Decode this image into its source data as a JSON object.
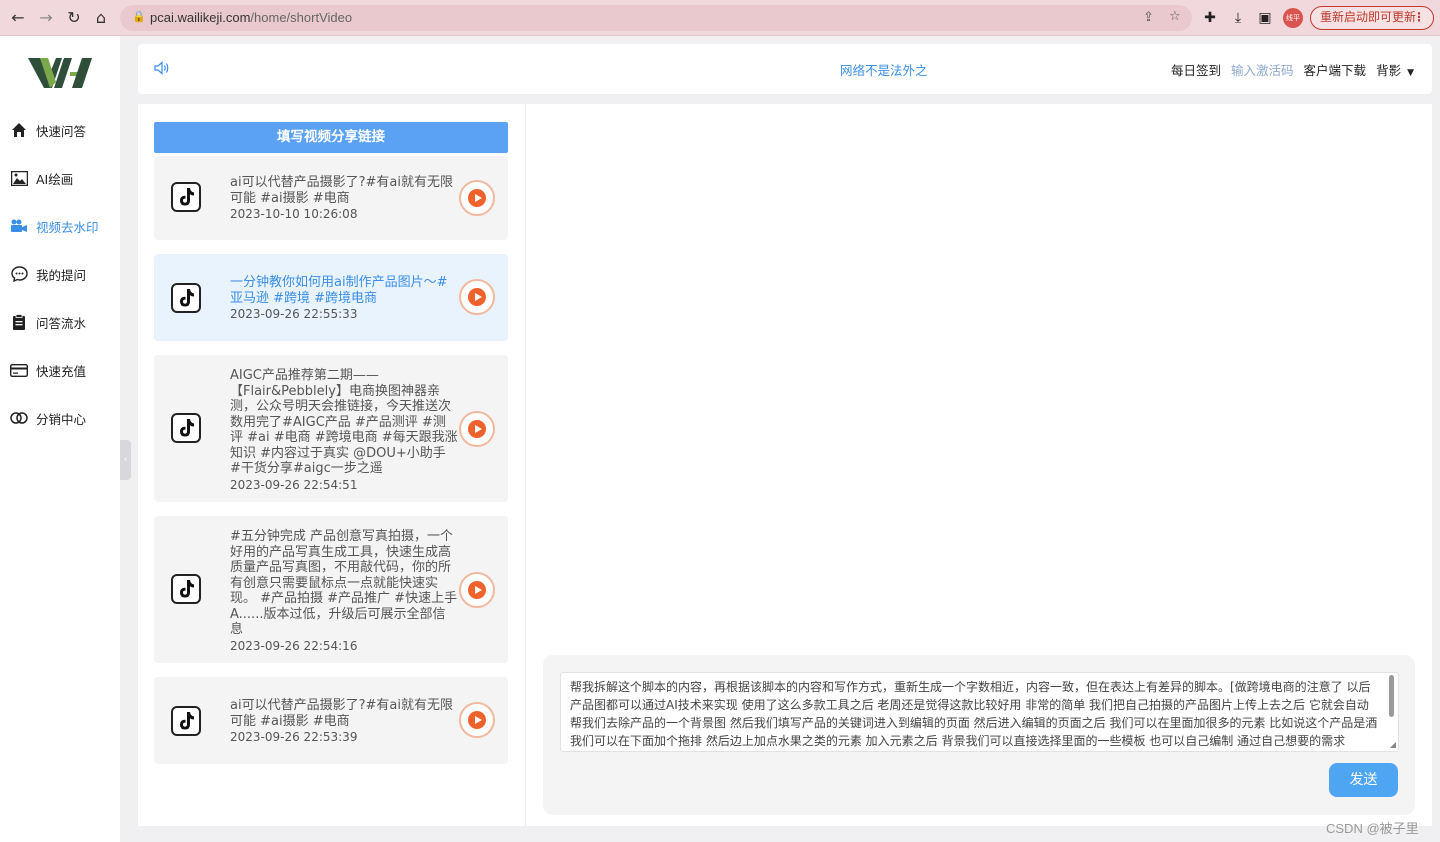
{
  "browser": {
    "url_host": "pcai.wailikeji.com",
    "url_path": "/home/shortVideo",
    "profile_label": "线平",
    "restart_label": "重新启动即可更新"
  },
  "sidebar": {
    "items": [
      {
        "label": "快速问答",
        "icon": "home-icon"
      },
      {
        "label": "AI绘画",
        "icon": "image-icon"
      },
      {
        "label": "视频去水印",
        "icon": "video-camera-icon",
        "active": true
      },
      {
        "label": "我的提问",
        "icon": "chat-bubble-icon"
      },
      {
        "label": "问答流水",
        "icon": "clipboard-icon"
      },
      {
        "label": "快速充值",
        "icon": "credit-card-icon"
      },
      {
        "label": "分销中心",
        "icon": "share-link-icon"
      }
    ]
  },
  "header": {
    "notice": "网络不是法外之",
    "links": {
      "checkin": "每日签到",
      "activation": "输入激活码",
      "download": "客户端下载",
      "background": "背影"
    }
  },
  "main": {
    "fill_button": "填写视频分享链接",
    "videos": [
      {
        "title": "ai可以代替产品摄影了?#有ai就有无限可能 #ai摄影 #电商",
        "date": "2023-10-10 10:26:08"
      },
      {
        "title": "一分钟教你如何用ai制作产品图片～#亚马逊 #跨境 #跨境电商",
        "date": "2023-09-26 22:55:33",
        "selected": true
      },
      {
        "title": "AIGC产品推荐第二期——【Flair&Pebblely】电商换图神器亲测，公众号明天会推链接，今天推送次数用完了#AIGC产品 #产品测评 #测评 #ai #电商 #跨境电商 #每天跟我涨知识 #内容过于真实 @DOU+小助手 #干货分享#aigc一步之遥",
        "date": "2023-09-26 22:54:51"
      },
      {
        "title": "#五分钟完成 产品创意写真拍摄，一个好用的产品写真生成工具，快速生成高质量产品写真图，不用敲代码，你的所有创意只需要鼠标点一点就能快速实现。 #产品拍摄 #产品推广 #快速上手A......版本过低，升级后可展示全部信息",
        "date": "2023-09-26 22:54:16"
      },
      {
        "title": "ai可以代替产品摄影了?#有ai就有无限可能 #ai摄影 #电商",
        "date": "2023-09-26 22:53:39"
      }
    ]
  },
  "prompt": {
    "text": "帮我拆解这个脚本的内容，再根据该脚本的内容和写作方式，重新生成一个字数相近，内容一致，但在表达上有差异的脚本。[做跨境电商的注意了 以后产品图都可以通过AI技术来实现 使用了这么多款工具之后 老周还是觉得这款比较好用 非常的简单 我们把自己拍摄的产品图片上传上去之后 它就会自动帮我们去除产品的一个背景图 然后我们填写产品的关键词进入到编辑的页面 然后进入编辑的页面之后 我们可以在里面加很多的元素 比如说这个产品是酒 我们可以在下面加个拖排 然后边上加点水果之类的元素 加入元素之后 背景我们可以直接选择里面的一些模板 也可以自己编制 通过自己想要的需求",
    "send_label": "发送"
  },
  "watermark": "CSDN @被子里",
  "colors": {
    "accent": "#3a8ee6",
    "button_blue": "#5ba2f4",
    "play_orange": "#f0622c"
  }
}
